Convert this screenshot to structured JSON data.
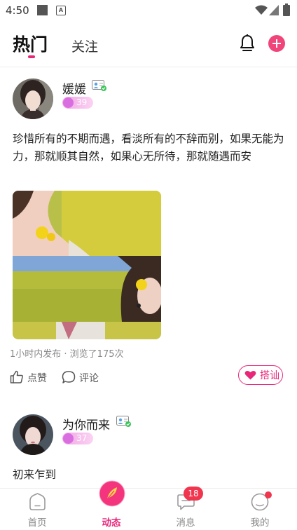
{
  "status_bar": {
    "time": "4:50",
    "a_icon": "A"
  },
  "header": {
    "tabs": [
      {
        "label": "热门",
        "active": true
      },
      {
        "label": "关注",
        "active": false
      }
    ]
  },
  "posts": [
    {
      "username": "媛媛",
      "level": "39",
      "text": "珍惜所有的不期而遇，看淡所有的不辞而别，如果无能为力，那就顺其自然，如果心无所待，那就随遇而安",
      "meta": "1小时内发布 · 浏览了175次",
      "like_label": "点赞",
      "comment_label": "评论",
      "chat_label": "搭讪"
    },
    {
      "username": "为你而来",
      "level": "37",
      "text": "初来乍到"
    }
  ],
  "bottom_nav": {
    "items": [
      {
        "label": "首页",
        "active": false
      },
      {
        "label": "动态",
        "active": true
      },
      {
        "label": "消息",
        "active": false,
        "badge": "18"
      },
      {
        "label": "我的",
        "active": false,
        "dot": true
      }
    ]
  },
  "colors": {
    "accent": "#e8277a",
    "badge": "#f0354f",
    "level_badge": "#f2a6e6"
  }
}
